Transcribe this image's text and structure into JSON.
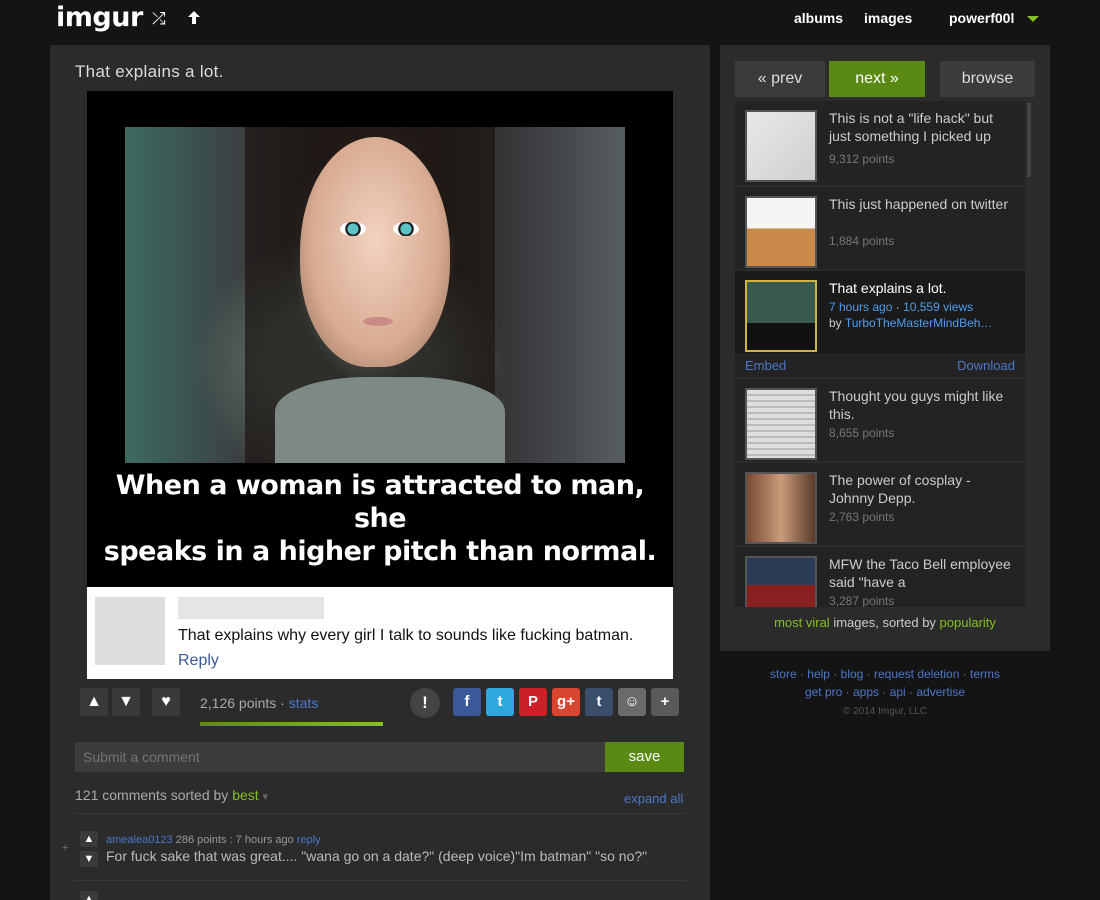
{
  "header": {
    "logo": "imgur",
    "nav": {
      "albums": "albums",
      "images": "images",
      "user": "powerf00l"
    }
  },
  "post": {
    "title": "That explains a lot.",
    "caption_line1": "When a woman is attracted to man, she",
    "caption_line2": "speaks in a higher pitch than normal.",
    "fb_comment": "That explains why every girl I talk to sounds like fucking batman.",
    "fb_reply": "Reply",
    "points": "2,126 points",
    "separator": " · ",
    "stats": "stats",
    "score_fraction": 0.9
  },
  "share": {
    "report": "!",
    "facebook": "f",
    "twitter": "t",
    "pinterest": "P",
    "googleplus": "g+",
    "tumblr": "t",
    "reddit": "☺",
    "more": "+"
  },
  "comment_form": {
    "placeholder": "Submit a comment",
    "save": "save"
  },
  "comments": {
    "count_text": "121 comments sorted by",
    "sort": "best",
    "expand_all": "expand all",
    "items": [
      {
        "author": "amealea0123",
        "points": "286 points",
        "time": "7 hours ago",
        "reply": "reply",
        "text": "For fuck sake that was great.... \"wana go on a date?\" (deep voice)\"Im batman\" \"so no?\""
      }
    ]
  },
  "sidebar": {
    "prev": "« prev",
    "next": "next »",
    "browse": "browse",
    "items": [
      {
        "title": "This is not a \"life hack\" but just something I picked up",
        "points": "9,312 points"
      },
      {
        "title": "This just happened on twitter",
        "points": "1,884 points"
      },
      {
        "title": "That explains a lot.",
        "time": "7 hours ago",
        "views": "10,559 views",
        "by": "by",
        "author": "TurboTheMasterMindBeh…"
      },
      {
        "title": "Thought you guys might like this.",
        "points": "8,655 points"
      },
      {
        "title": "The power of cosplay - Johnny Depp.",
        "points": "2,763 points"
      },
      {
        "title": "MFW the Taco Bell employee said \"have a",
        "points": "3,287 points"
      }
    ],
    "embed": "Embed",
    "download": "Download",
    "sort_footer": {
      "most_viral": "most viral",
      "images": " images, sorted by ",
      "popularity": "popularity"
    }
  },
  "footer": {
    "line1": "store · help · blog · request deletion · terms",
    "line2": "get pro · apps · api · advertise",
    "copyright": "© 2014 Imgur, LLC"
  },
  "colors": {
    "accent": "#85bf25",
    "link": "#4e76c9",
    "panel": "#2b2b2b",
    "bg": "#141414"
  },
  "icons": [
    "random-icon",
    "upload-icon",
    "chevron-down-icon",
    "upvote-icon",
    "downvote-icon",
    "heart-icon",
    "report-icon",
    "facebook-icon",
    "twitter-icon",
    "pinterest-icon",
    "googleplus-icon",
    "tumblr-icon",
    "reddit-icon",
    "plus-icon"
  ]
}
